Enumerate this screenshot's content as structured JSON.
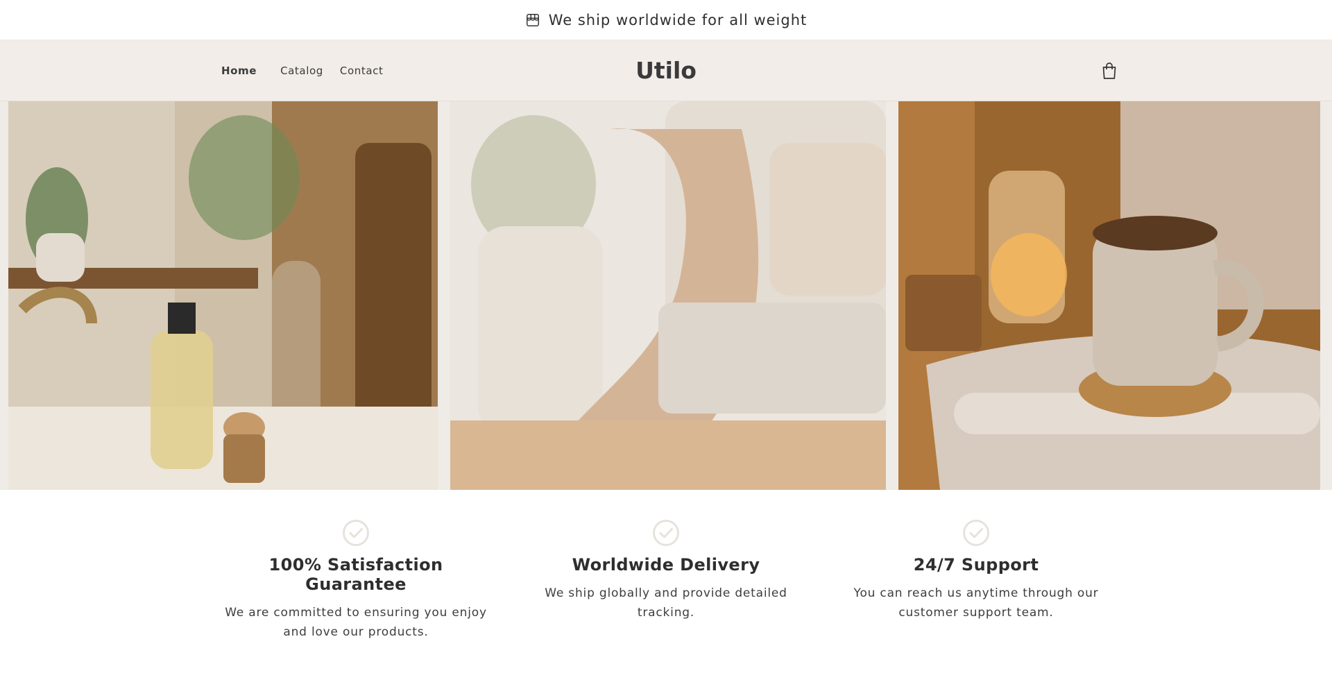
{
  "announcement": {
    "icon": "store-icon",
    "text": "We ship worldwide for all weight"
  },
  "header": {
    "nav": [
      {
        "label": "Home",
        "active": true
      },
      {
        "label": "Catalog",
        "active": false
      },
      {
        "label": "Contact",
        "active": false
      }
    ],
    "logo": "Utilo",
    "cart_icon": "shopping-bag-icon"
  },
  "gallery": {
    "images": [
      {
        "name": "bathroom-vanity-image"
      },
      {
        "name": "sofa-throw-image"
      },
      {
        "name": "mug-towels-image"
      }
    ]
  },
  "features": [
    {
      "icon": "check-circle-icon",
      "title": "100% Satisfaction Guarantee",
      "text": "We are committed to ensuring you enjoy and love our products."
    },
    {
      "icon": "check-circle-icon",
      "title": "Worldwide Delivery",
      "text": "We ship globally and provide detailed tracking."
    },
    {
      "icon": "check-circle-icon",
      "title": "24/7 Support",
      "text": "You can reach us anytime through our customer support team."
    }
  ],
  "colors": {
    "header_bg": "#f2ede8",
    "text": "#2e2e30",
    "check": "#e6e2dc"
  }
}
